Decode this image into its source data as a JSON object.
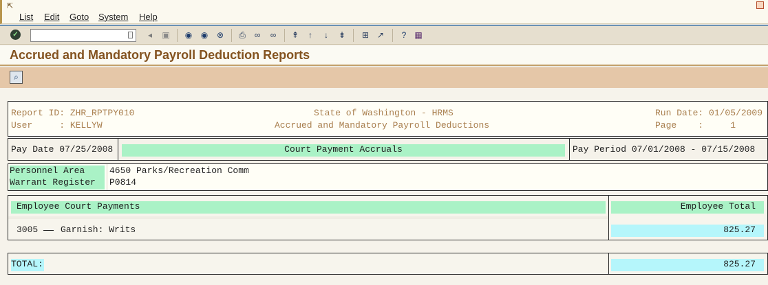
{
  "menu": {
    "items": [
      "List",
      "Edit",
      "Goto",
      "System",
      "Help"
    ]
  },
  "toolbar": {
    "command_value": ""
  },
  "page": {
    "title": "Accrued and Mandatory Payroll Deduction Reports"
  },
  "report": {
    "report_id_line": "Report ID: ZHR_RPTPY010",
    "user_line": "User     : KELLYW",
    "org_title": "State of Washington - HRMS",
    "report_title": "Accrued and Mandatory Payroll Deductions",
    "run_date_line": "Run Date: 01/05/2009",
    "page_line": "Page    :     1",
    "pay_date": "Pay Date 07/25/2008",
    "section_title": "Court Payment Accruals",
    "pay_period": "Pay Period 07/01/2008 - 07/15/2008",
    "personnel_area_label": "Personnel Area",
    "personnel_area_value": "4650 Parks/Recreation Comm",
    "warrant_register_label": "Warrant Register",
    "warrant_register_value": "P0814",
    "col_left_header": "Employee Court Payments",
    "col_right_header": "Employee Total",
    "row_code": "3005",
    "row_desc": "Garnish: Writs",
    "row_amount": "825.27",
    "total_label": "TOTAL:",
    "total_amount": "825.27"
  },
  "colors": {
    "title_brown": "#83521f",
    "label_green": "#aaf2c6",
    "value_cyan": "#b5f6fb"
  }
}
